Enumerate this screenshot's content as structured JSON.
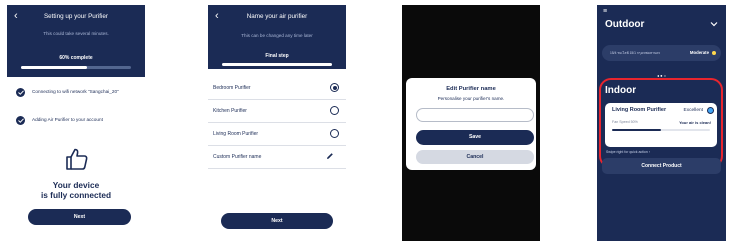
{
  "screen1": {
    "title": "Setting up your Purifier",
    "subtitle": "This could take several minutes.",
    "progress_label": "60% complete",
    "progress_value": 0.6,
    "steps": [
      {
        "text": "Connecting to wifi network \"Sangchai_20\""
      },
      {
        "text": "Adding Air Purifier to your account"
      }
    ],
    "status_line1": "Your device",
    "status_line2": "is fully connected",
    "button": "Next"
  },
  "screen2": {
    "title": "Name your air purifier",
    "subtitle": "This can be changed any time later",
    "step_label": "Final step",
    "options": [
      {
        "label": "Bedroom Purifier",
        "selected": true
      },
      {
        "label": "Kitchen Purifier",
        "selected": false
      },
      {
        "label": "Living Room Purifier",
        "selected": false
      },
      {
        "label": "Custom Purifier name",
        "selected": false
      }
    ],
    "button": "Next"
  },
  "screen3": {
    "title": "Edit Purifier name",
    "subtitle": "Personalise your purifier's name.",
    "input_value": "",
    "save": "Save",
    "cancel": "Cancel"
  },
  "screen4": {
    "outdoor_title": "Outdoor",
    "aqi_text": "15/4 ชม.ไลฟ์ 15/1 กรุงเทพมหานคร",
    "aqi_status": "Moderate",
    "aqi_color": "#ffd84d",
    "indoor_title": "Indoor",
    "device_name": "Living Room Purifier",
    "air_quality": "Excellent",
    "fan_speed": "Fan Speed 50%",
    "fan_level": 0.5,
    "air_message": "Your air is clean!",
    "swipe_hint": "Swipe right for quick action",
    "connect_button": "Connect Product"
  },
  "colors": {
    "navy": "#1b2b55",
    "highlight": "#e8252e"
  }
}
